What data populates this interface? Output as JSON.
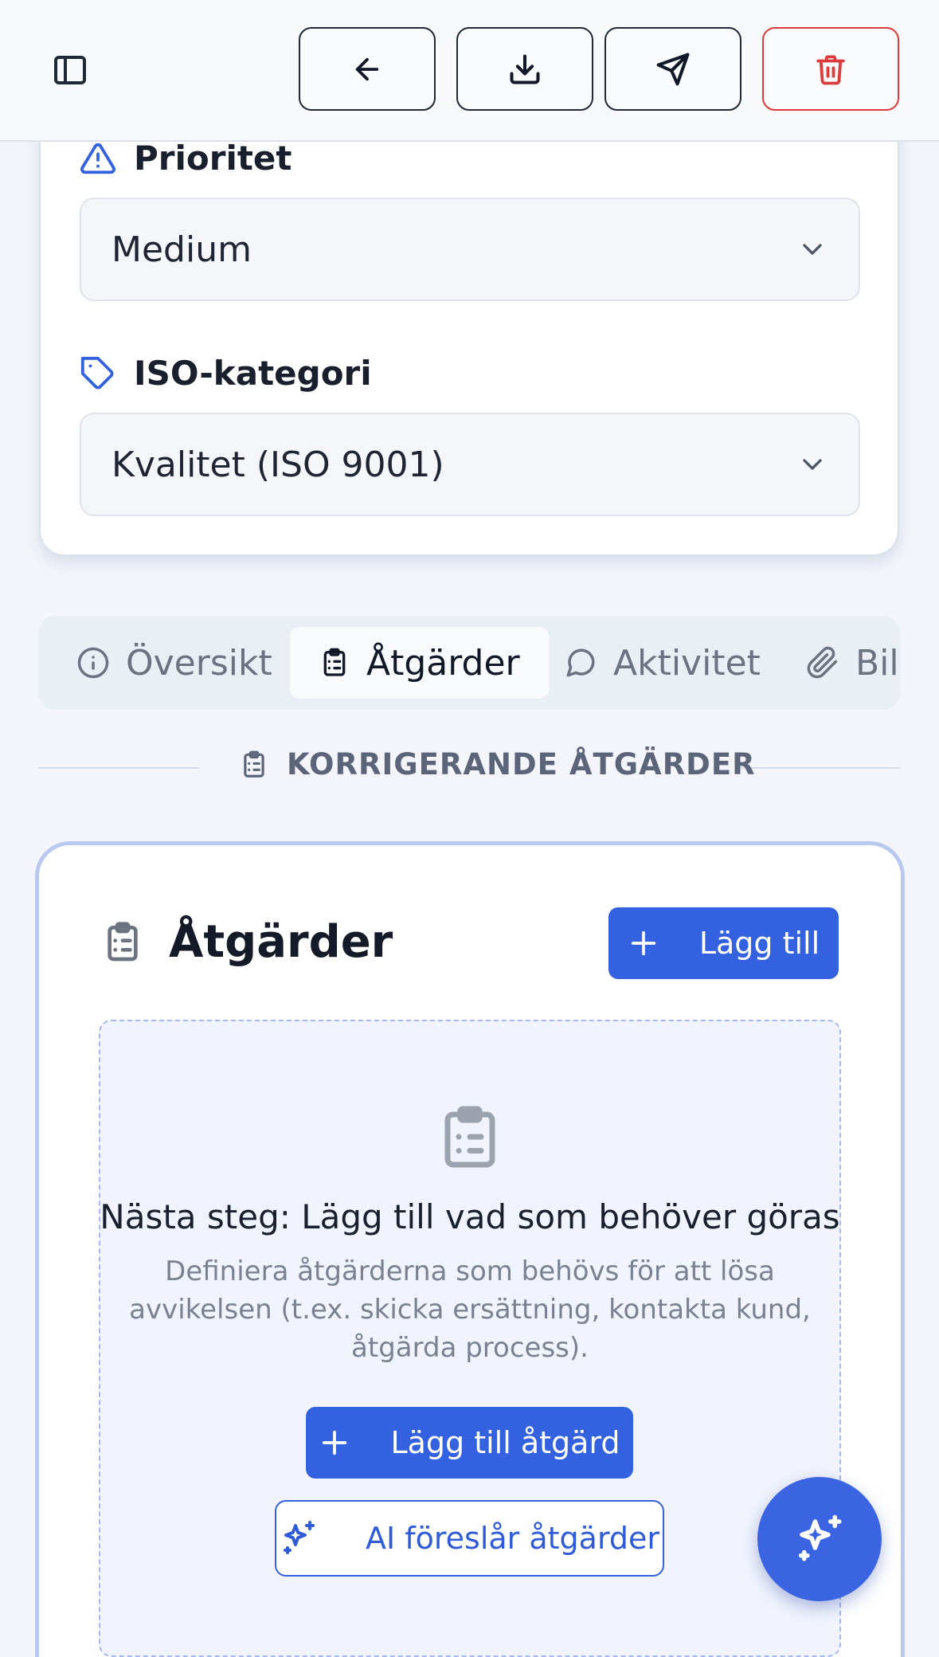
{
  "fields": {
    "priority": {
      "label": "Prioritet",
      "value": "Medium"
    },
    "iso_category": {
      "label": "ISO-kategori",
      "value": "Kvalitet (ISO 9001)"
    }
  },
  "tabs": [
    {
      "label": "Översikt",
      "icon": "info-icon"
    },
    {
      "label": "Åtgärder",
      "icon": "clipboard-list-icon",
      "active": true
    },
    {
      "label": "Aktivitet",
      "icon": "message-circle-icon"
    },
    {
      "label": "Bila",
      "icon": "paperclip-icon"
    }
  ],
  "section": {
    "title": "KORRIGERANDE ÅTGÄRDER"
  },
  "actions": {
    "title": "Åtgärder",
    "add_label": "Lägg till",
    "empty_title": "Nästa steg: Lägg till vad som behöver göras",
    "empty_desc": "Definiera åtgärderna som behövs för att lösa avvikelsen (t.ex. skicka ersättning, kontakta kund, åtgärda process).",
    "add_action_label": "Lägg till åtgärd",
    "ai_suggest_label": "AI föreslår åtgärder"
  },
  "colors": {
    "accent": "#3461e0",
    "danger": "#dc3c3c",
    "border": "#dfe3ec",
    "muted": "#6b7280"
  }
}
